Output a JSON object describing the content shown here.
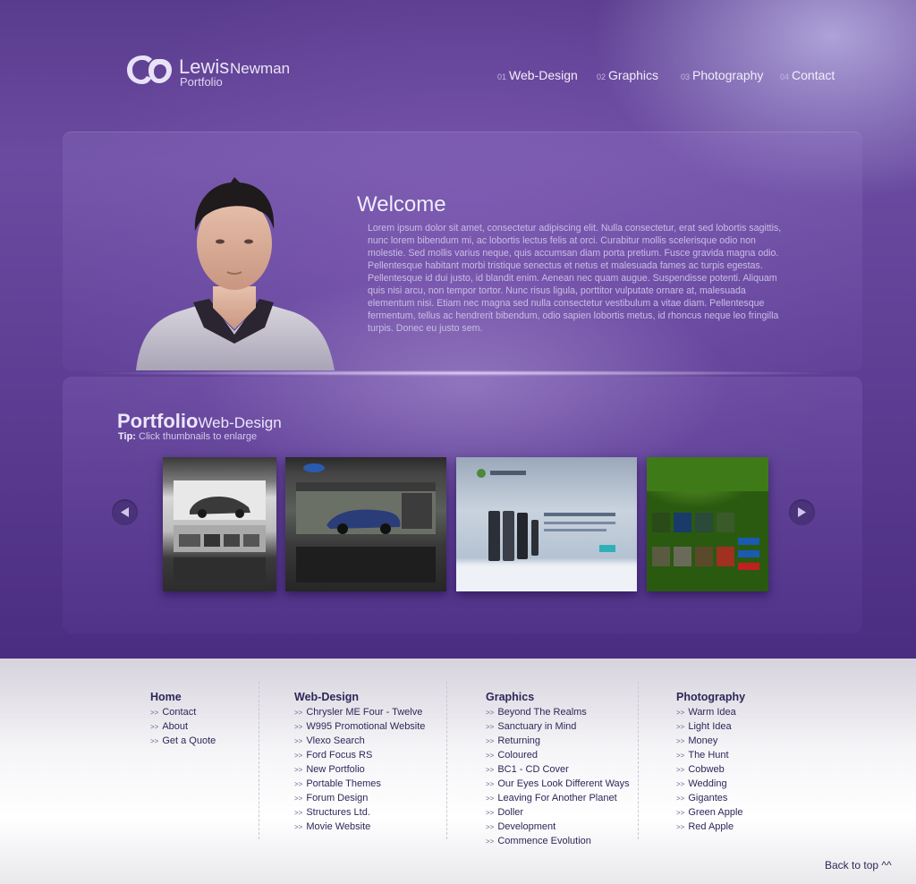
{
  "brand": {
    "first_name": "Lewis",
    "last_name": "Newman",
    "subtitle": "Portfolio",
    "logo_icon": "ln-logo-mark"
  },
  "nav": {
    "items": [
      {
        "num": "01",
        "label": "Web-Design"
      },
      {
        "num": "02",
        "label": "Graphics"
      },
      {
        "num": "03",
        "label": "Photography"
      },
      {
        "num": "04",
        "label": "Contact"
      }
    ]
  },
  "welcome": {
    "title": "Welcome",
    "body": "Lorem ipsum dolor sit amet, consectetur adipiscing elit. Nulla consectetur, erat sed lobortis sagittis, nunc lorem bibendum mi, ac lobortis lectus felis at orci. Curabitur mollis scelerisque odio non molestie. Sed mollis varius neque, quis accumsan diam porta pretium. Fusce gravida magna odio. Pellentesque habitant morbi tristique senectus et netus et malesuada fames ac turpis egestas. Pellentesque id dui justo, id blandit enim. Aenean nec quam augue. Suspendisse potenti. Aliquam quis nisi arcu, non tempor tortor. Nunc risus ligula, porttitor vulputate ornare at, malesuada elementum nisi. Etiam nec magna sed nulla consectetur vestibulum a vitae diam. Pellentesque fermentum, tellus ac hendrerit bibendum, odio sapien lobortis metus, id rhoncus neque leo fringilla turpis. Donec eu justo sem."
  },
  "portfolio": {
    "title_bold": "Portfolio",
    "title_sub": "Web-Design",
    "tip_label": "Tip:",
    "tip_text": "Click thumbnails to enlarge",
    "prev_icon": "arrow-left-icon",
    "next_icon": "arrow-right-icon"
  },
  "footer": {
    "columns": [
      {
        "heading": "Home",
        "items": [
          "Contact",
          "About",
          "Get a Quote"
        ]
      },
      {
        "heading": "Web-Design",
        "items": [
          "Chrysler ME Four - Twelve",
          "W995 Promotional Website",
          "Vlexo Search",
          "Ford Focus RS",
          "New Portfolio",
          "Portable Themes",
          "Forum Design",
          "Structures Ltd.",
          "Movie Website"
        ]
      },
      {
        "heading": "Graphics",
        "items": [
          "Beyond The Realms",
          "Sanctuary in Mind",
          "Returning",
          "Coloured",
          "BC1 - CD Cover",
          "Our Eyes Look Different Ways",
          "Leaving For Another Planet",
          "Doller",
          "Development",
          "Commence Evolution"
        ]
      },
      {
        "heading": "Photography",
        "items": [
          "Warm Idea",
          "Light Idea",
          "Money",
          "The Hunt",
          "Cobweb",
          "Wedding",
          "Gigantes",
          "Green Apple",
          "Red Apple"
        ]
      }
    ],
    "item_prefix": ">>",
    "back_to_top": "Back to top ^^"
  },
  "colors": {
    "stage_purple": "#5c3d92",
    "footer_text": "#2e2758",
    "nav_text": "#f2eefb"
  }
}
